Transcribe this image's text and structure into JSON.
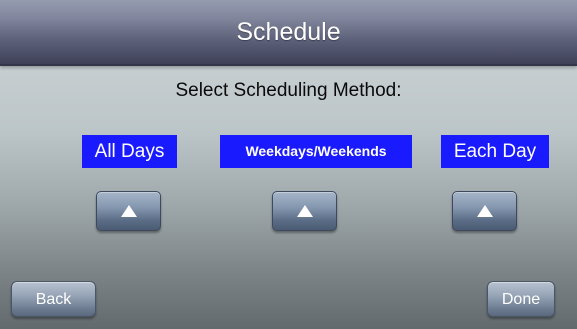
{
  "header": {
    "title": "Schedule"
  },
  "prompt": "Select Scheduling Method:",
  "options": [
    {
      "label": "All Days",
      "button_icon": "up-arrow"
    },
    {
      "label": "Weekdays/Weekends",
      "button_icon": "up-arrow"
    },
    {
      "label": "Each Day",
      "button_icon": "up-arrow"
    }
  ],
  "footer": {
    "back_label": "Back",
    "done_label": "Done"
  },
  "colors": {
    "label_background": "#1a1aff",
    "label_text": "#ffffff",
    "title_text": "#ffffff"
  }
}
